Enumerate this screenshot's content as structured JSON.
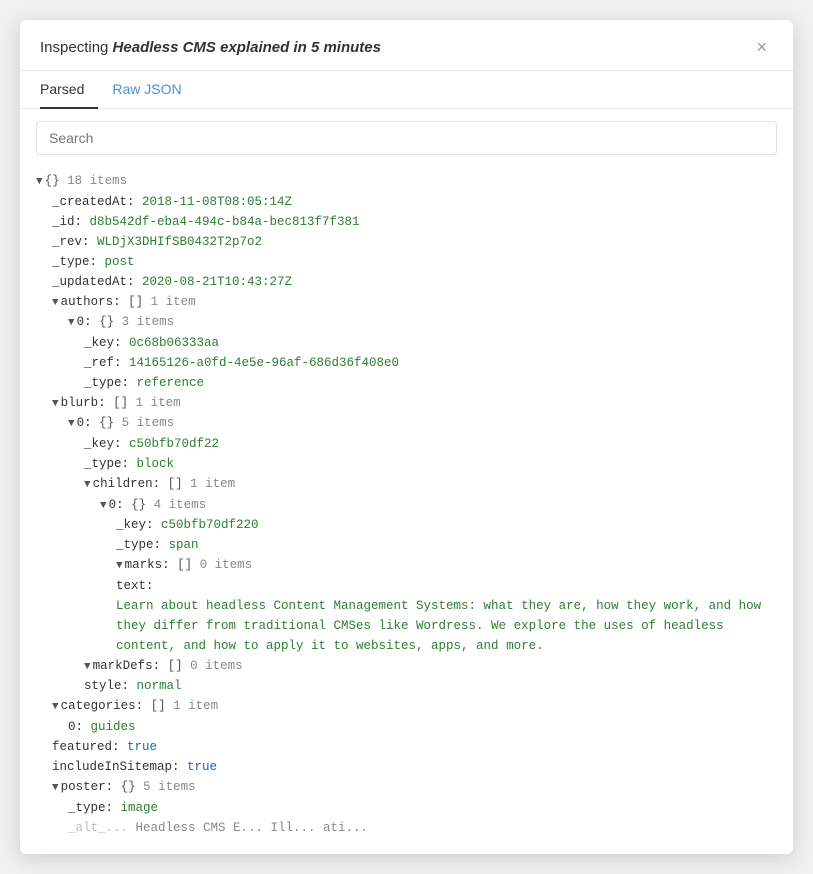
{
  "header": {
    "title_prefix": "Inspecting ",
    "title_em": "Headless CMS explained in 5 minutes",
    "close_label": "×"
  },
  "tabs": [
    {
      "id": "parsed",
      "label": "Parsed",
      "active": true
    },
    {
      "id": "raw-json",
      "label": "Raw JSON",
      "active": false
    }
  ],
  "search": {
    "placeholder": "Search"
  },
  "tree": {
    "root_meta": "{} 18 items",
    "lines": []
  }
}
